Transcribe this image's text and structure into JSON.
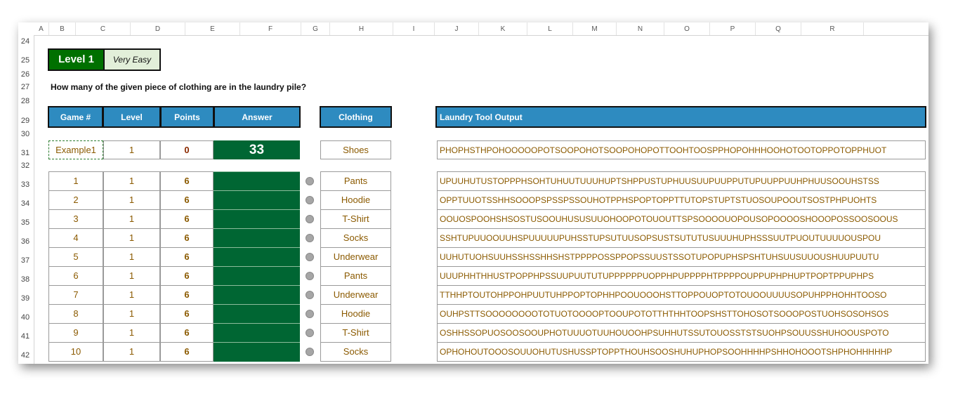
{
  "columns": [
    "A",
    "B",
    "C",
    "D",
    "E",
    "F",
    "G",
    "H",
    "I",
    "J",
    "K",
    "L",
    "M",
    "N",
    "O",
    "P",
    "Q",
    "R"
  ],
  "rows": [
    "24",
    "25",
    "26",
    "27",
    "28",
    "29",
    "30",
    "31",
    "32",
    "33",
    "34",
    "35",
    "36",
    "37",
    "38",
    "39",
    "40",
    "41",
    "42"
  ],
  "level": {
    "title": "Level 1",
    "difficulty": "Very Easy"
  },
  "question": "How many of the given piece of clothing are in the laundry pile?",
  "headers": {
    "game": "Game #",
    "level": "Level",
    "points": "Points",
    "answer": "Answer",
    "clothing": "Clothing",
    "output": "Laundry Tool Output"
  },
  "example": {
    "game": "Example1",
    "level": "1",
    "points": "0",
    "answer": "33",
    "clothing": "Shoes",
    "output": "PHOPHSTHPOHOOOOOPOTSOOPOHOTSOOPOHOPOTTOOHTOOSPPHOPOHHHOOHOTOOTOPPOTOPPHUOT"
  },
  "games": [
    {
      "game": "1",
      "level": "1",
      "points": "6",
      "clothing": "Pants",
      "output": "UPUUHUTUSTOPPPHSOHTUHUUTUUUHUPTSHPPUSTUPHUUSUUPUUPPUTUPUUPPUUHPHUUSOOUHSTSS"
    },
    {
      "game": "2",
      "level": "1",
      "points": "6",
      "clothing": "Hoodie",
      "output": "OPPTUUOTSSHHSOOOPSPSSPSSOUHOTPPHSPOPTOPPTTUTOPSTUPTSTUOSOUPOOUTSOSTPHPUOHTS"
    },
    {
      "game": "3",
      "level": "1",
      "points": "6",
      "clothing": "T-Shirt",
      "output": "OOUOSPOOHSHSOSTUSOOUHUSUSUUOHOOPOTOUOUTTSPSOOOOUOPOUSOPOOOOSHOOOPOSSOOSOOUS"
    },
    {
      "game": "4",
      "level": "1",
      "points": "6",
      "clothing": "Socks",
      "output": "SSHTUPUUOOUUHSPUUUUUPUHSSTUPSUTUUSOPSUSTSUTUTUSUUUHUPHSSSUUTPUOUTUUUUOUSPOU"
    },
    {
      "game": "5",
      "level": "1",
      "points": "6",
      "clothing": "Underwear",
      "output": "UUHUTUOHSUUHSSHSSHHSHSTPPPPOSSPPOPSSUUSTSSOTUPOPUPHSPSHTUHSUUSUUOUSHUUPUUTU"
    },
    {
      "game": "6",
      "level": "1",
      "points": "6",
      "clothing": "Pants",
      "output": "UUUPHHTHHUSTPOPPHPSSUUPUUTUTUPPPPPPUOPPHPUPPPPHTPPPPOUPPUPHPHUPTPOPTPPUPHPS"
    },
    {
      "game": "7",
      "level": "1",
      "points": "6",
      "clothing": "Underwear",
      "output": "TTHHPTOUTOHPPOHPUUTUHPPOPTOPHHPOOUOOOHSTTOPPOUOPTOTOUOOUUUUSOPUHPPHOHHTOOSO"
    },
    {
      "game": "8",
      "level": "1",
      "points": "6",
      "clothing": "Hoodie",
      "output": "OUHPSTTSOOOOOOOOTOTUOTOOOOPTOOUPOTOTTHTHHTOOPSHSTTOHOSOTSOOOPOSTUOHSOSOHSOS"
    },
    {
      "game": "9",
      "level": "1",
      "points": "6",
      "clothing": "T-Shirt",
      "output": "OSHHSSOPUOSOOSOOUPHOTUUUOTUUHOUOOHPSUHHUTSSUTOUOSSTSTSUOHPSOUUSSHUHOOUSPOTO"
    },
    {
      "game": "10",
      "level": "1",
      "points": "6",
      "clothing": "Socks",
      "output": "OPHOHOUTOOOSOUUOHUTUSHUSSPTOPPTHOUHSOOSHUHUPHOPSOOHHHHPSHHOHOOOTSHPHOHHHHHP"
    }
  ]
}
